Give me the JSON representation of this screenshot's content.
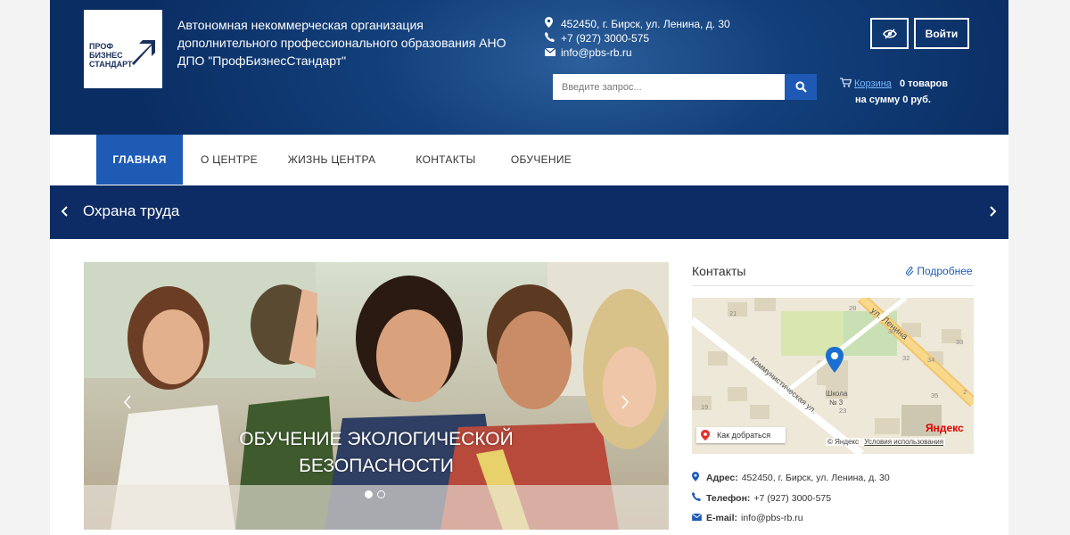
{
  "header": {
    "logo_text": [
      "ПРОФ",
      "БИЗНЕС",
      "СТАНДАРТ"
    ],
    "org_line1": "Автономная некоммерческая организация",
    "org_line2": "дополнительного профессионального образования АНО",
    "org_line3": "ДПО \"ПрофБизнесСтандарт\"",
    "address": "452450, г. Бирск, ул. Ленина, д. 30",
    "phone": "+7 (927) 3000-575",
    "email": "info@pbs-rb.ru",
    "login_label": "Войти",
    "search_placeholder": "Введите запрос...",
    "cart_link": "Корзина",
    "cart_count": "0 товаров",
    "cart_sum_prefix": "на сумму",
    "cart_sum": "0 руб."
  },
  "nav": {
    "items": [
      "ГЛАВНАЯ",
      "О ЦЕНТРЕ",
      "ЖИЗНЬ ЦЕНТРА",
      "КОНТАКТЫ",
      "ОБУЧЕНИЕ"
    ]
  },
  "banner": {
    "title": "Охрана труда"
  },
  "slider": {
    "caption_line1": "ОБУЧЕНИЕ ЭКОЛОГИЧЕСКОЙ",
    "caption_line2": "БЕЗОПАСНОСТИ",
    "slide_count": 2,
    "active_slide": 1
  },
  "sidebar": {
    "title": "Контакты",
    "more_label": "Подробнее",
    "map": {
      "street1": "ул. Ленина",
      "street2": "Коммунистическая ул.",
      "school": "Школа",
      "school_no": "№ 3",
      "route_label": "Как добраться",
      "copyright": "© Яндекс",
      "terms": "Условия использования",
      "brand": "Яндекс",
      "house_numbers": [
        "21",
        "23",
        "28",
        "30",
        "32",
        "33",
        "34",
        "35",
        "19",
        "21",
        "23",
        "20",
        "2"
      ]
    },
    "address_label": "Адрес:",
    "address_value": "452450, г. Бирск, ул. Ленина, д. 30",
    "phone_label": "Телефон:",
    "phone_value": "+7 (927) 3000-575",
    "email_label": "E-mail:",
    "email_value": "info@pbs-rb.ru"
  },
  "colors": {
    "accent": "#1d5bb5",
    "header_dark": "#0a2d63",
    "banner": "#0d2b64"
  }
}
